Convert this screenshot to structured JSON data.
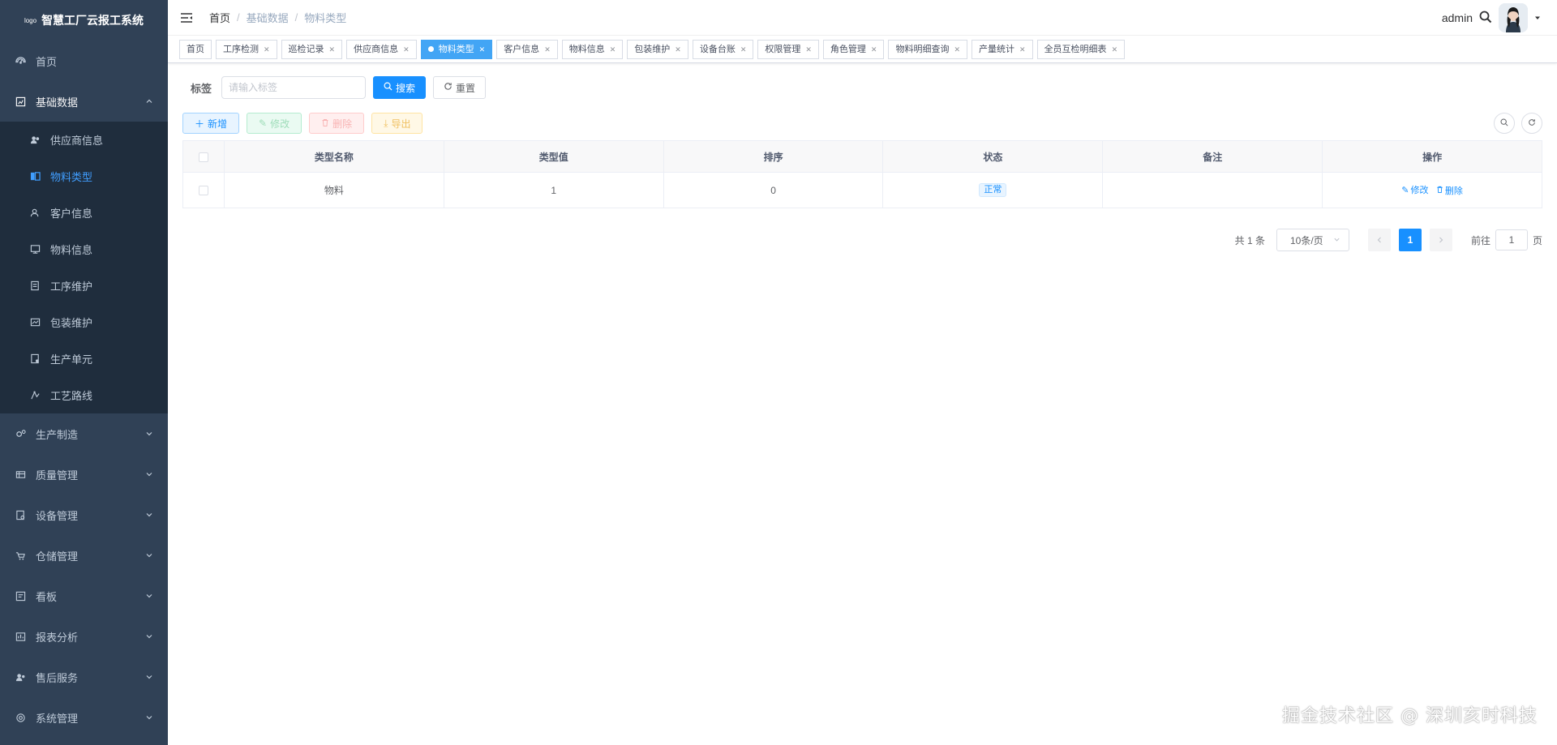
{
  "sidebar": {
    "logo_small": "logo",
    "title": "智慧工厂云报工系统",
    "items": [
      {
        "label": "首页",
        "icon": "dashboard-icon"
      },
      {
        "label": "基础数据",
        "icon": "base-data-icon",
        "open": true,
        "children": [
          {
            "label": "供应商信息",
            "icon": "supplier-icon"
          },
          {
            "label": "物料类型",
            "icon": "material-type-icon",
            "active": true
          },
          {
            "label": "客户信息",
            "icon": "customer-icon"
          },
          {
            "label": "物料信息",
            "icon": "material-info-icon"
          },
          {
            "label": "工序维护",
            "icon": "process-icon"
          },
          {
            "label": "包装维护",
            "icon": "package-icon"
          },
          {
            "label": "生产单元",
            "icon": "unit-icon"
          },
          {
            "label": "工艺路线",
            "icon": "route-icon"
          }
        ]
      },
      {
        "label": "生产制造",
        "icon": "production-icon"
      },
      {
        "label": "质量管理",
        "icon": "quality-icon"
      },
      {
        "label": "设备管理",
        "icon": "equipment-icon"
      },
      {
        "label": "仓储管理",
        "icon": "warehouse-icon"
      },
      {
        "label": "看板",
        "icon": "board-icon"
      },
      {
        "label": "报表分析",
        "icon": "report-icon"
      },
      {
        "label": "售后服务",
        "icon": "service-icon"
      },
      {
        "label": "系统管理",
        "icon": "system-icon"
      }
    ]
  },
  "navbar": {
    "breadcrumb": [
      "首页",
      "基础数据",
      "物料类型"
    ],
    "username": "admin"
  },
  "tags": [
    {
      "label": "首页",
      "closable": false
    },
    {
      "label": "工序检测",
      "closable": true
    },
    {
      "label": "巡检记录",
      "closable": true
    },
    {
      "label": "供应商信息",
      "closable": true
    },
    {
      "label": "物料类型",
      "closable": true,
      "active": true
    },
    {
      "label": "客户信息",
      "closable": true
    },
    {
      "label": "物料信息",
      "closable": true
    },
    {
      "label": "包装维护",
      "closable": true
    },
    {
      "label": "设备台账",
      "closable": true
    },
    {
      "label": "权限管理",
      "closable": true
    },
    {
      "label": "角色管理",
      "closable": true
    },
    {
      "label": "物料明细查询",
      "closable": true
    },
    {
      "label": "产量统计",
      "closable": true
    },
    {
      "label": "全员互检明细表",
      "closable": true
    }
  ],
  "search": {
    "label": "标签",
    "placeholder": "请输入标签",
    "search_btn": "搜索",
    "reset_btn": "重置"
  },
  "toolbar": {
    "add": "新增",
    "edit": "修改",
    "delete": "删除",
    "export": "导出"
  },
  "table": {
    "columns": [
      "类型名称",
      "类型值",
      "排序",
      "状态",
      "备注",
      "操作"
    ],
    "rows": [
      {
        "name": "物料",
        "value": "1",
        "sort": "0",
        "status": "正常",
        "remark": "",
        "op_edit": "修改",
        "op_delete": "删除"
      }
    ]
  },
  "pagination": {
    "total": "共 1 条",
    "page_size": "10条/页",
    "current": "1",
    "goto_prefix": "前往",
    "goto_value": "1",
    "goto_suffix": "页"
  },
  "watermark": "掘金技术社区 @ 深圳亥时科技",
  "colors": {
    "sidebar_bg": "#304156",
    "submenu_bg": "#1f2d3d",
    "primary": "#1890ff",
    "active_tag": "#42a5f5"
  }
}
